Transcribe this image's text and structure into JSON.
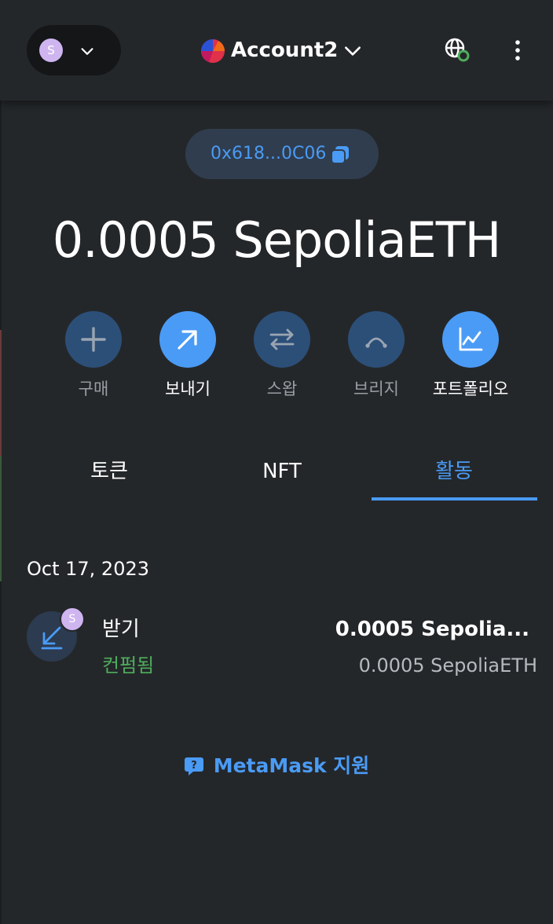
{
  "header": {
    "network_avatar_letter": "S",
    "account_name": "Account2",
    "icons": [
      "chevron-down-icon",
      "globe-connected-icon",
      "kebab-menu-icon"
    ]
  },
  "address": {
    "short": "0x618...0C06",
    "icon": "copy-icon"
  },
  "balance": {
    "amount": "0.0005 SepoliaETH"
  },
  "actions": [
    {
      "label": "구매",
      "icon": "plus-icon",
      "enabled": false
    },
    {
      "label": "보내기",
      "icon": "arrow-up-right-icon",
      "enabled": true
    },
    {
      "label": "스왑",
      "icon": "swap-arrows-icon",
      "enabled": false
    },
    {
      "label": "브리지",
      "icon": "bridge-icon",
      "enabled": false
    },
    {
      "label": "포트폴리오",
      "icon": "chart-icon",
      "enabled": true
    }
  ],
  "tabs": [
    {
      "label": "토큰",
      "active": false
    },
    {
      "label": "NFT",
      "active": false
    },
    {
      "label": "활동",
      "active": true
    }
  ],
  "activity": {
    "date": "Oct 17, 2023",
    "transactions": [
      {
        "title": "받기",
        "status": "컨펌됨",
        "badge_letter": "S",
        "primary_amount": "0.0005 Sepolia...",
        "secondary_amount": "0.0005 SepoliaETH"
      }
    ]
  },
  "support": {
    "label": "MetaMask 지원"
  },
  "colors": {
    "background": "#24272a",
    "accent": "#4a9bf5",
    "success": "#4fad5c",
    "dim_button": "#2c4f78",
    "avatar": "#cfb5f0"
  }
}
